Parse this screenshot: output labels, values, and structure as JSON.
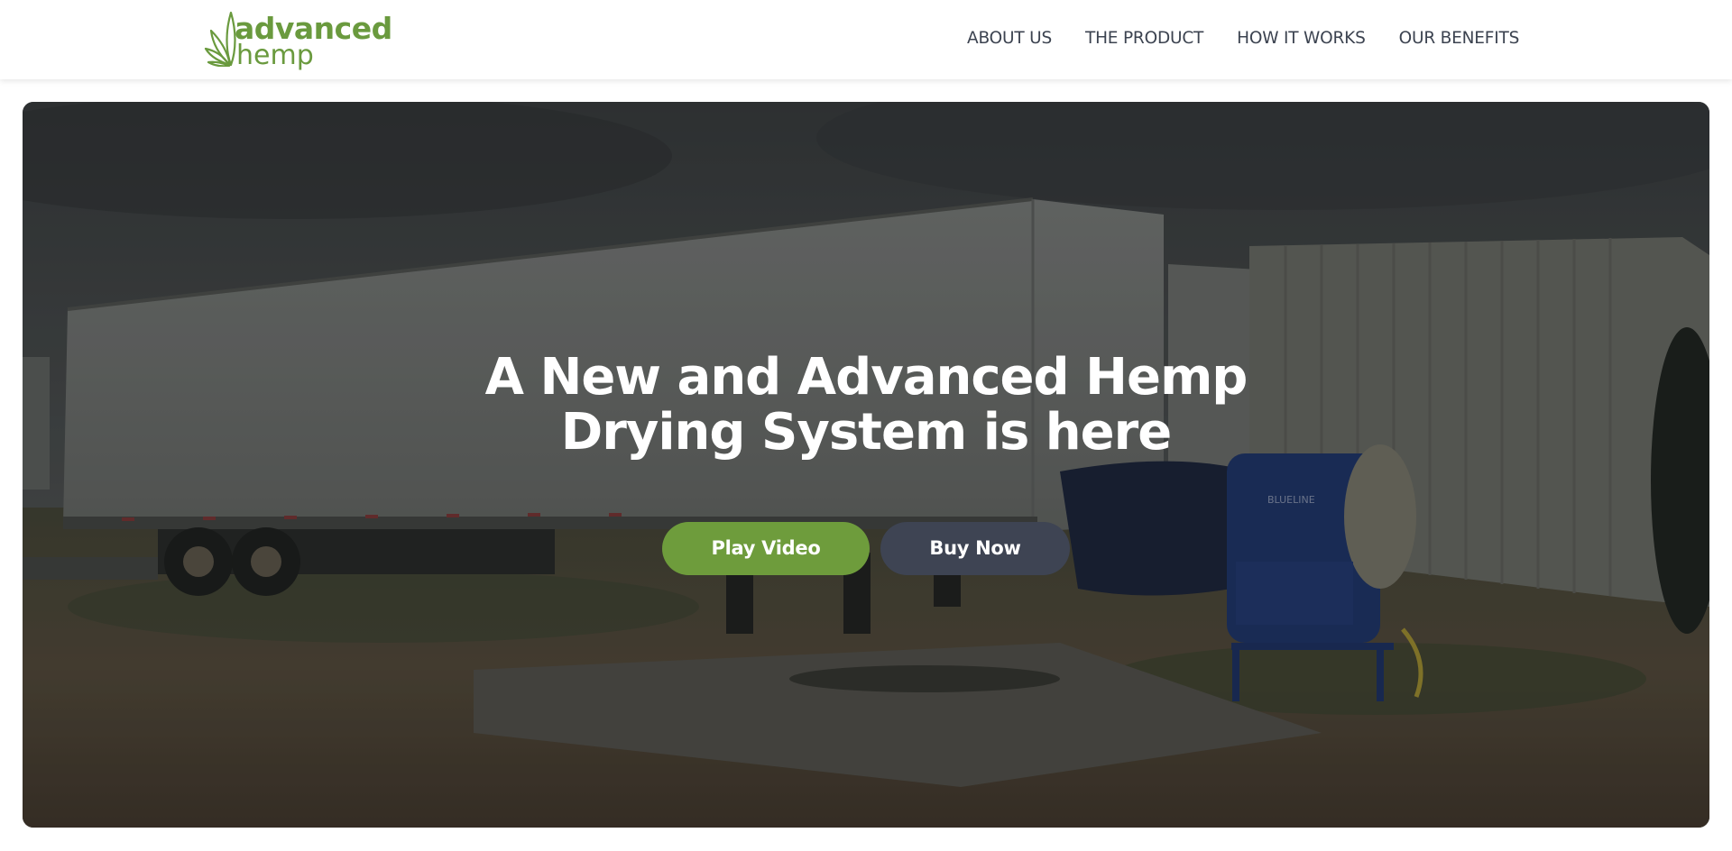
{
  "header": {
    "logo": {
      "word1": "advanced",
      "word2": "hemp",
      "color": "#6a9a3e"
    },
    "nav": [
      {
        "label": "ABOUT US"
      },
      {
        "label": "THE PRODUCT"
      },
      {
        "label": "HOW IT WORKS"
      },
      {
        "label": "OUR BENEFITS"
      }
    ]
  },
  "hero": {
    "title_line1": "A New and Advanced Hemp",
    "title_line2": "Drying System is here",
    "play_label": "Play Video",
    "buy_label": "Buy Now",
    "fan_brand": "BLUELINE"
  },
  "colors": {
    "brand_green": "#6e9c3c",
    "button_dark": "#3e4453",
    "nav_text": "#3c4350"
  }
}
